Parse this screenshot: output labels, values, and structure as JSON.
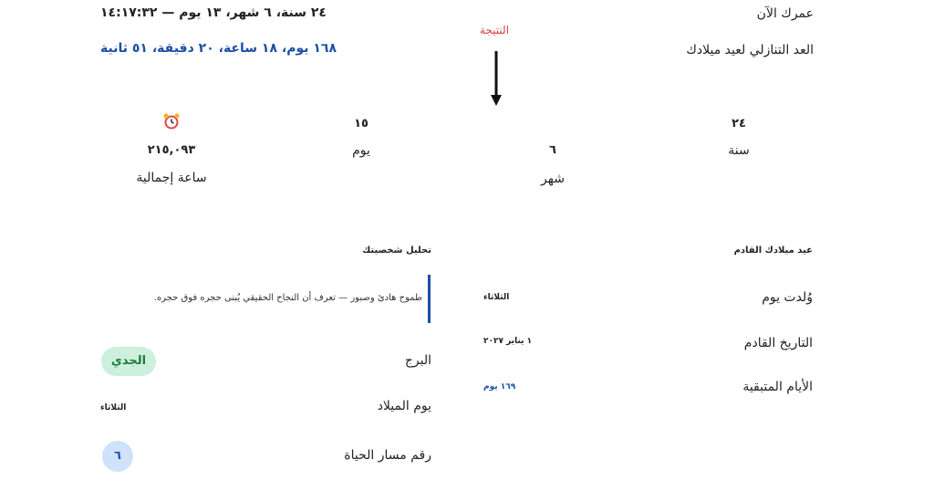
{
  "top": {
    "age_label": "عمرك الآن",
    "age_value": "٢٤ سنة، ٦ شهر، ١٣ يوم — ١٤:١٧:٣٢",
    "countdown_label": "العد التنازلي لعيد ميلادك",
    "countdown_value": "١٦٨ يوم، ١٨ ساعة، ٢٠ دقيقة، ٥١ ثانية"
  },
  "annotation": {
    "label": "النتيجة"
  },
  "stats": {
    "years": {
      "value": "٢٤",
      "label": "سنة"
    },
    "months": {
      "value": "٦",
      "label": "شهر"
    },
    "days": {
      "value": "١٥",
      "label": "يوم"
    },
    "hours": {
      "icon": "alarm-clock-icon",
      "value": "٢١٥,٠٩٣",
      "label": "ساعة إجمالية"
    }
  },
  "birthday": {
    "heading": "عيد ميلادك القادم",
    "rows": [
      {
        "label": "وُلدت يوم",
        "value": "الثلاثاء"
      },
      {
        "label": "التاريخ القادم",
        "value": "١ يناير ٢٠٢٧"
      },
      {
        "label": "الأيام المتبقية",
        "value": "١٦٩ يوم"
      }
    ]
  },
  "personality": {
    "heading": "تحليل شخصيتك",
    "quote": "طموح هادئ وصبور — تعرف أن النجاح الحقيقي يُبنى حجره فوق حجره.",
    "zodiac_label": "البرج",
    "zodiac_value": "الجدي",
    "birth_day_label": "يوم الميلاد",
    "birth_day_value": "الثلاثاء",
    "life_path_label": "رقم مسار الحياة",
    "life_path_value": "٦"
  },
  "colors": {
    "accent_blue": "#1c4fa8",
    "zodiac_pill_bg": "#cdf0dc",
    "zodiac_pill_text": "#1e7a3e",
    "life_path_bg": "#cfe2fa",
    "annotation_red": "#e03a3a"
  }
}
